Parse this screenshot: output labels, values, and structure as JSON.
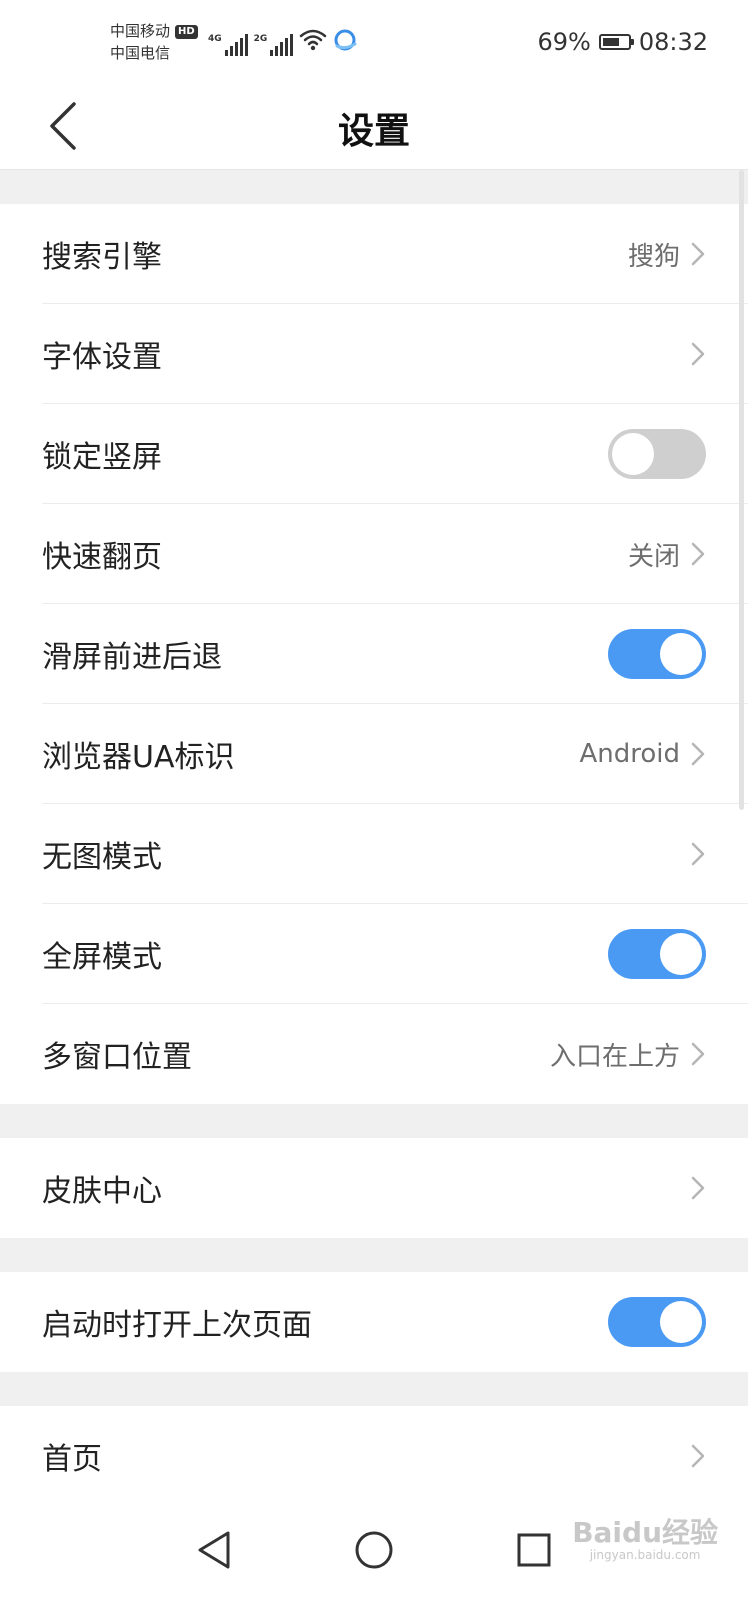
{
  "status_bar": {
    "carrier_1": "中国移动",
    "hd_badge": "HD",
    "carrier_2": "中国电信",
    "signal_1_gen": "4G",
    "signal_2_gen": "2G",
    "battery_percent": "69%",
    "battery_level": 0.69,
    "time": "08:32"
  },
  "header": {
    "title": "设置",
    "back_icon": "chevron-left-icon"
  },
  "group_main": [
    {
      "label": "搜索引擎",
      "value": "搜狗"
    },
    {
      "label": "字体设置",
      "value": ""
    },
    {
      "label": "锁定竖屏",
      "toggle": false
    },
    {
      "label": "快速翻页",
      "value": "关闭"
    },
    {
      "label": "滑屏前进后退",
      "toggle": true
    },
    {
      "label": "浏览器UA标识",
      "value": "Android"
    },
    {
      "label": "无图模式",
      "value": ""
    },
    {
      "label": "全屏模式",
      "toggle": true
    },
    {
      "label": "多窗口位置",
      "value": "入口在上方"
    }
  ],
  "group_skin": {
    "label": "皮肤中心"
  },
  "group_startup": {
    "label": "启动时打开上次页面",
    "toggle": true
  },
  "group_home": {
    "label": "首页"
  },
  "nav_bar": {
    "back_icon": "triangle-back-icon",
    "home_icon": "circle-home-icon",
    "recents_icon": "square-recents-icon"
  },
  "watermark": {
    "logo_text": "Baidu经验",
    "url": "jingyan.baidu.com"
  },
  "colors": {
    "accent": "#4a9af4",
    "toggle_off": "#cfcfcf",
    "divider": "#ececec",
    "section_gap": "#f0f0f0"
  }
}
